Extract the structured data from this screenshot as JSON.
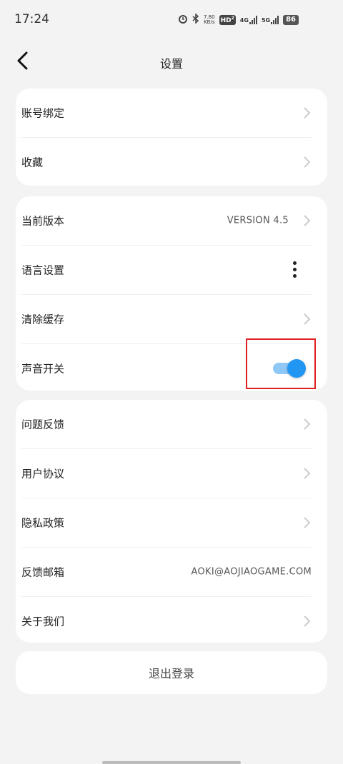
{
  "status": {
    "time": "17:24",
    "net_speed_value": "7.80",
    "net_speed_unit": "KB/s",
    "hd_label": "HD",
    "hd_sub": "2",
    "net1": "4G",
    "net2": "5G",
    "battery": "86"
  },
  "header": {
    "title": "设置"
  },
  "group1": [
    {
      "label": "账号绑定"
    },
    {
      "label": "收藏"
    }
  ],
  "group2": {
    "version_label": "当前版本",
    "version_value": "VERSION 4.5",
    "language_label": "语言设置",
    "clear_cache_label": "清除缓存",
    "sound_label": "声音开关",
    "sound_on": true
  },
  "group3": {
    "feedback_label": "问题反馈",
    "user_agreement_label": "用户协议",
    "privacy_label": "隐私政策",
    "feedback_email_label": "反馈邮箱",
    "feedback_email_value": "AOKI@AOJIAOGAME.COM",
    "about_label": "关于我们"
  },
  "logout_label": "退出登录",
  "colors": {
    "accent": "#2196f3",
    "track": "#8fc7f7",
    "highlight": "#e02020"
  }
}
